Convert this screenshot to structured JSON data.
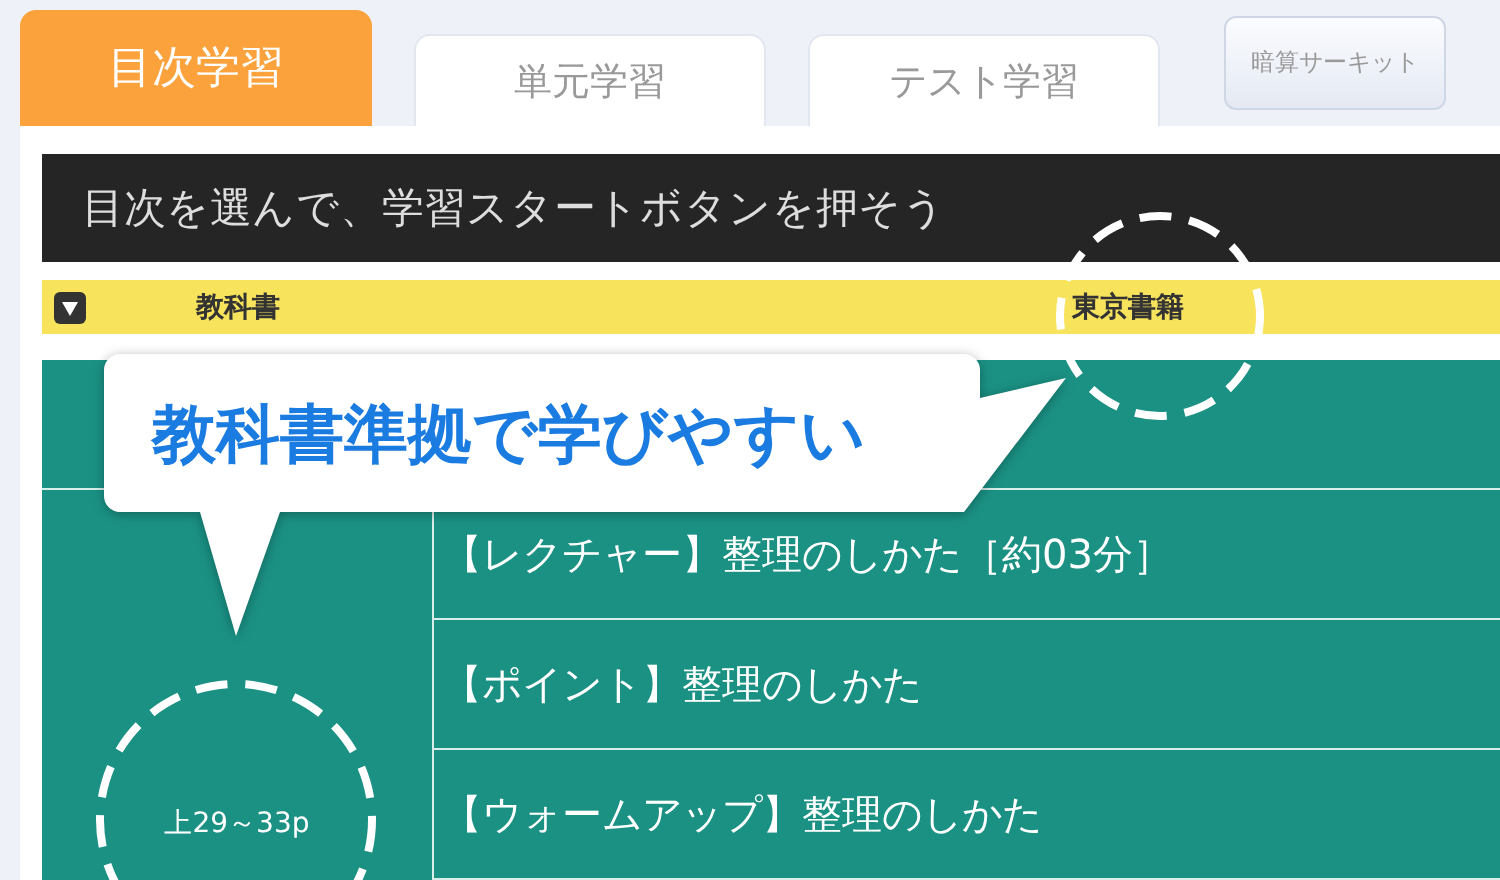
{
  "tabs": [
    {
      "label": "目次学習",
      "selected": true
    },
    {
      "label": "単元学習",
      "selected": false
    },
    {
      "label": "テスト学習",
      "selected": false
    }
  ],
  "side_button": {
    "label": "暗算サーキット"
  },
  "instruction": "目次を選んで、学習スタートボタンを押そう",
  "textbook_row": {
    "label": "教科書",
    "value": "東京書籍"
  },
  "section": {
    "pages": "上29～33p",
    "items": [
      {
        "label": "【レクチャー】整理のしかた［約03分］"
      },
      {
        "label": "【ポイント】整理のしかた"
      },
      {
        "label": "【ウォームアップ】整理のしかた"
      }
    ]
  },
  "callout": "教科書準拠で学びやすい"
}
